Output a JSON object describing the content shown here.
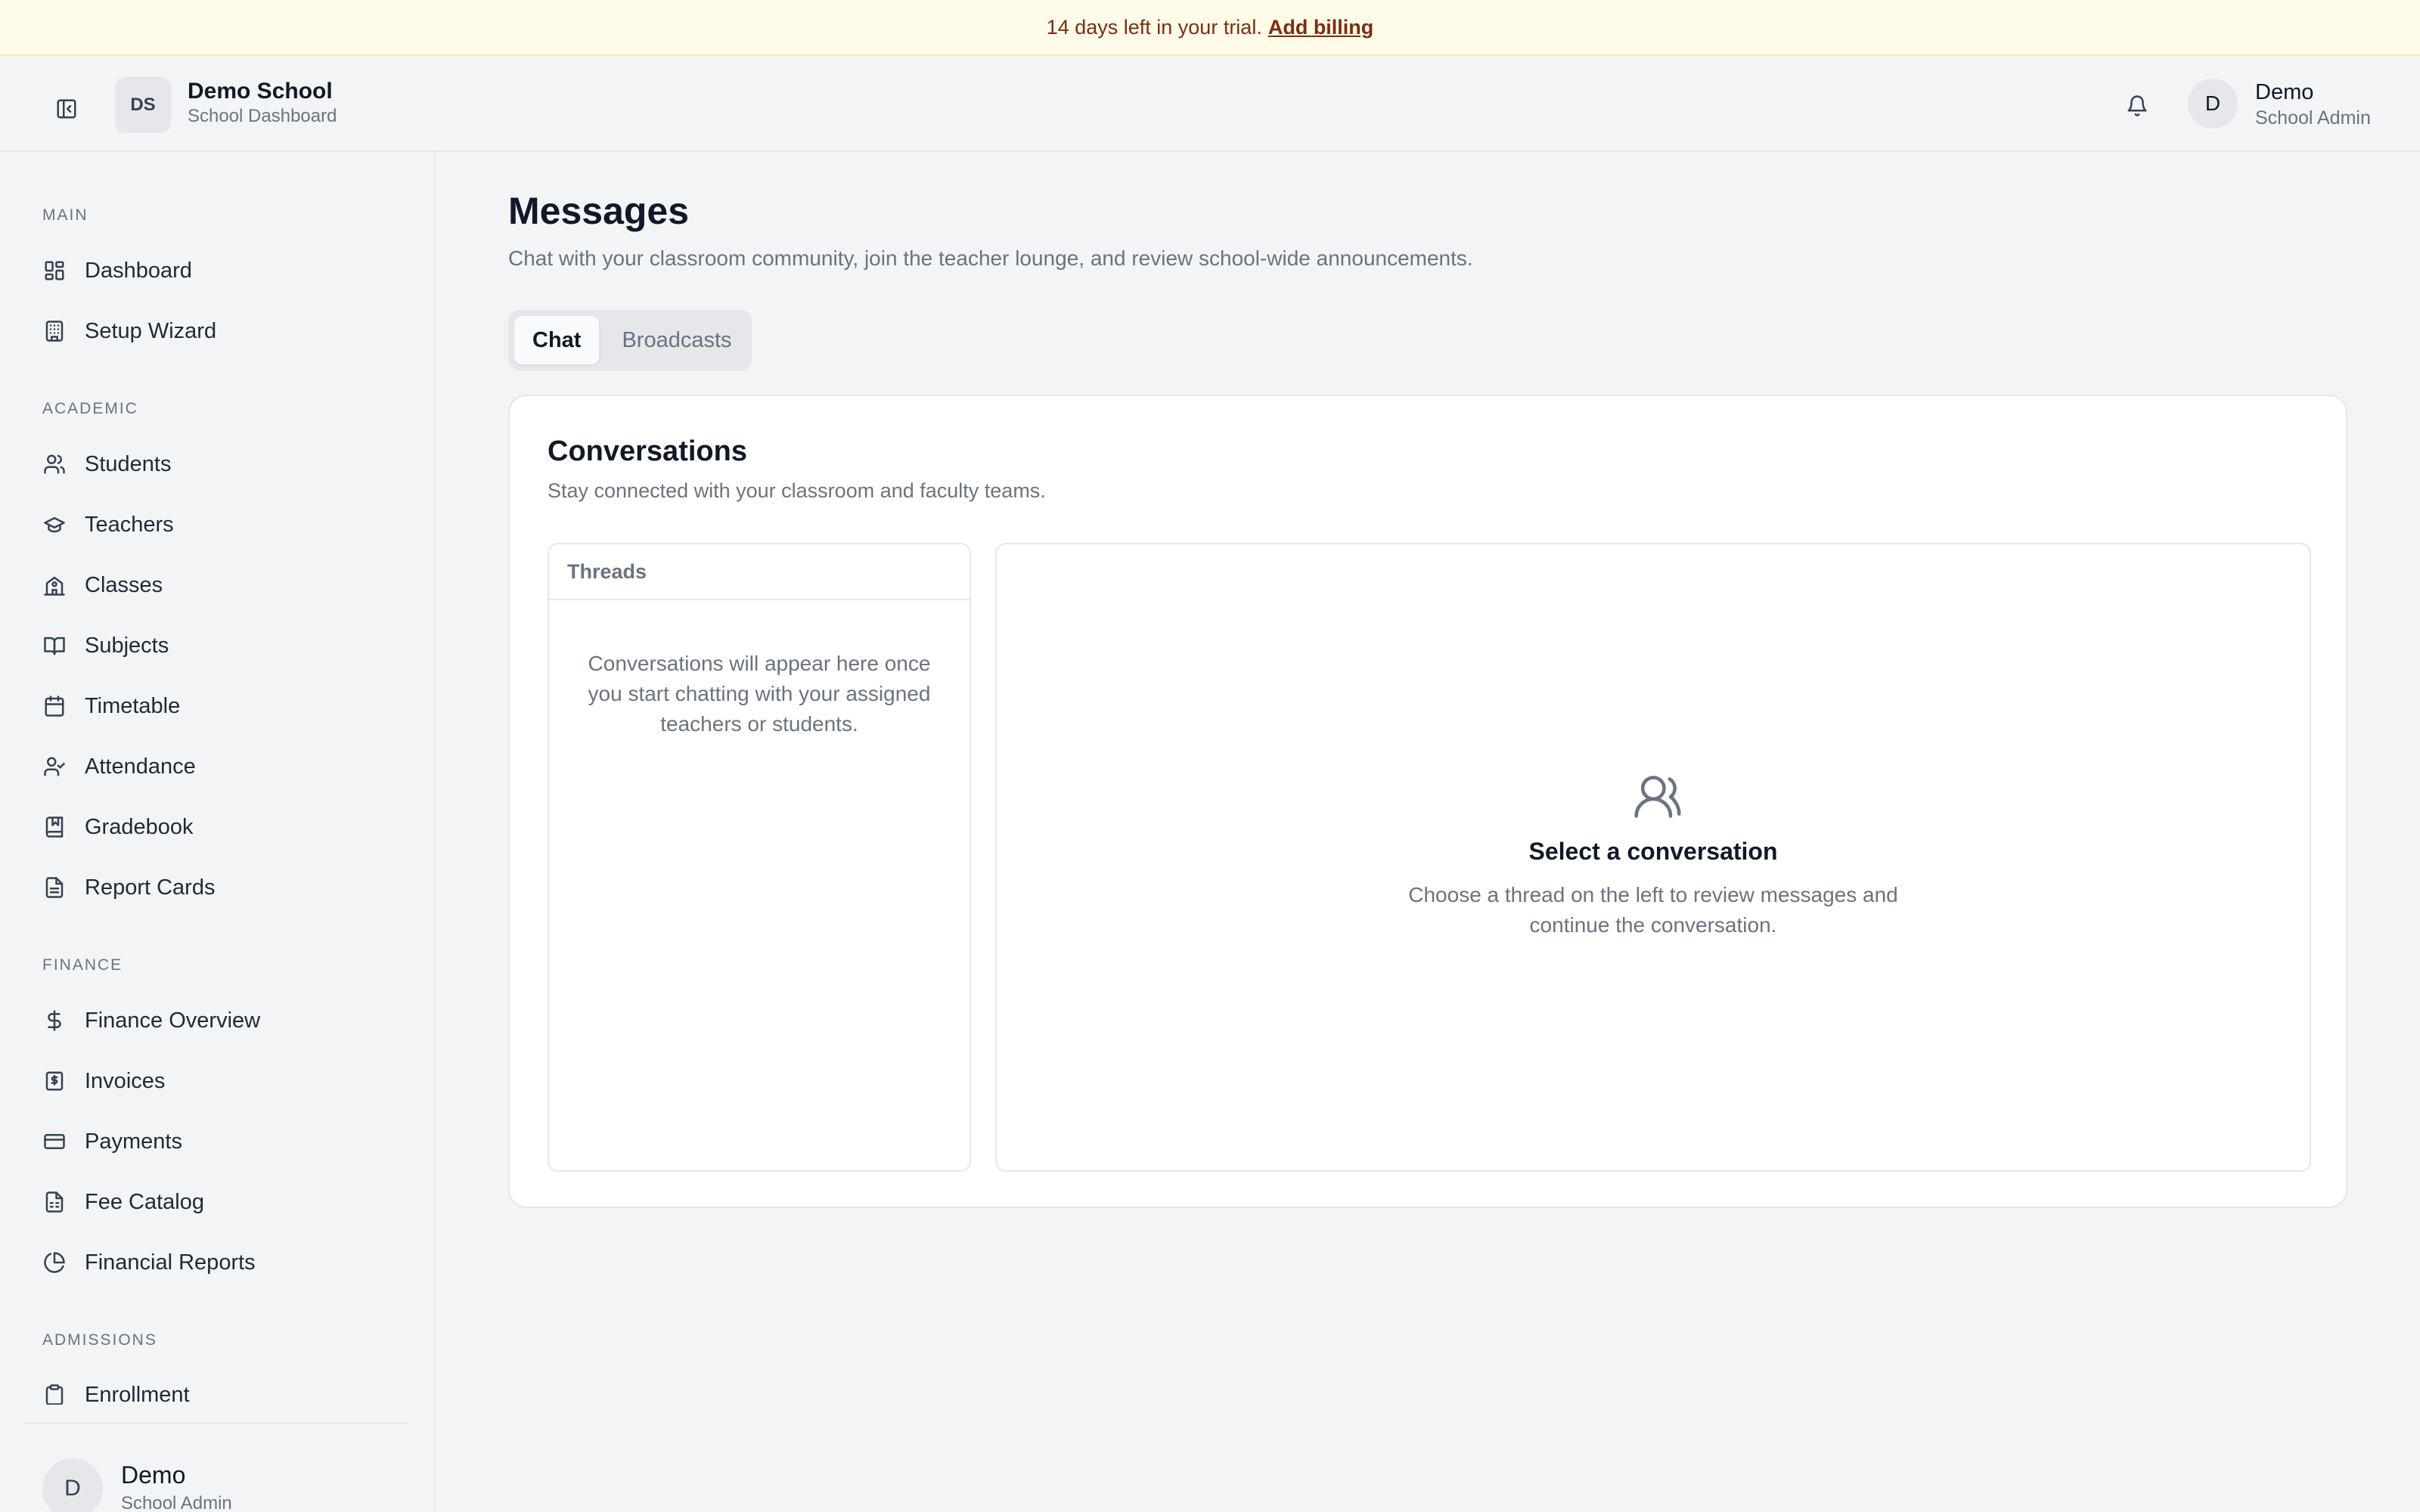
{
  "banner": {
    "text": "14 days left in your trial.",
    "link": "Add billing"
  },
  "header": {
    "school_initials": "DS",
    "school_name": "Demo School",
    "school_sub": "School Dashboard",
    "user_initial": "D",
    "user_name": "Demo",
    "user_role": "School Admin"
  },
  "sidebar": {
    "sections": [
      {
        "label": "MAIN",
        "items": [
          {
            "label": "Dashboard",
            "icon": "dashboard-icon"
          },
          {
            "label": "Setup Wizard",
            "icon": "building-icon"
          }
        ]
      },
      {
        "label": "ACADEMIC",
        "items": [
          {
            "label": "Students",
            "icon": "users-icon"
          },
          {
            "label": "Teachers",
            "icon": "graduation-cap-icon"
          },
          {
            "label": "Classes",
            "icon": "school-icon"
          },
          {
            "label": "Subjects",
            "icon": "book-open-icon"
          },
          {
            "label": "Timetable",
            "icon": "calendar-icon"
          },
          {
            "label": "Attendance",
            "icon": "user-check-icon"
          },
          {
            "label": "Gradebook",
            "icon": "bookmark-book-icon"
          },
          {
            "label": "Report Cards",
            "icon": "file-text-icon"
          }
        ]
      },
      {
        "label": "FINANCE",
        "items": [
          {
            "label": "Finance Overview",
            "icon": "dollar-icon"
          },
          {
            "label": "Invoices",
            "icon": "receipt-icon"
          },
          {
            "label": "Payments",
            "icon": "credit-card-icon"
          },
          {
            "label": "Fee Catalog",
            "icon": "file-spreadsheet-icon"
          },
          {
            "label": "Financial Reports",
            "icon": "pie-chart-icon"
          }
        ]
      },
      {
        "label": "ADMISSIONS",
        "items": [
          {
            "label": "Enrollment",
            "icon": "clipboard-icon"
          }
        ]
      }
    ],
    "footer": {
      "initial": "D",
      "name": "Demo",
      "role": "School Admin"
    }
  },
  "main": {
    "title": "Messages",
    "subtitle": "Chat with your classroom community, join the teacher lounge, and review school-wide announcements.",
    "tabs": [
      {
        "label": "Chat",
        "active": true
      },
      {
        "label": "Broadcasts",
        "active": false
      }
    ],
    "card": {
      "title": "Conversations",
      "subtitle": "Stay connected with your classroom and faculty teams.",
      "threads_header": "Threads",
      "threads_empty": "Conversations will appear here once you start chatting with your assigned teachers or students.",
      "empty_title": "Select a conversation",
      "empty_desc": "Choose a thread on the left to review messages and continue the conversation."
    }
  },
  "colors": {
    "banner_bg": "#fefbe8",
    "banner_text": "#7c2d12",
    "page_bg": "#f3f4f6",
    "text_muted": "#6b7280"
  }
}
